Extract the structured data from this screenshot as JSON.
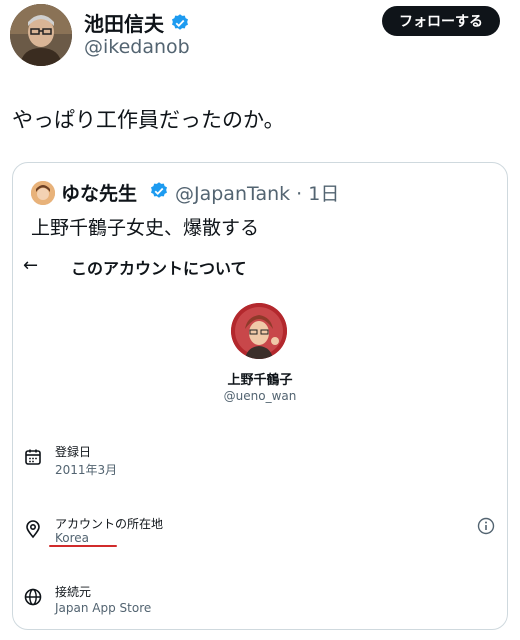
{
  "header": {
    "display_name": "池田信夫",
    "handle": "@ikedanob",
    "follow_label": "フォローする",
    "verified_icon": "verified-badge-icon"
  },
  "tweet": {
    "text": "やっぱり工作員だったのか。"
  },
  "quote": {
    "display_name": "ゆな先生",
    "handle_time": "@JapanTank · 1日",
    "text": "上野千鶴子女史、爆散する"
  },
  "about": {
    "title": "このアカウントについて",
    "profile_name": "上野千鶴子",
    "profile_handle": "@ueno_wan",
    "rows": [
      {
        "label": "登録日",
        "value": "2011年3月",
        "icon": "calendar-icon"
      },
      {
        "label": "アカウントの所在地",
        "value": "Korea",
        "icon": "location-pin-icon"
      },
      {
        "label": "接続元",
        "value": "Japan App Store",
        "icon": "globe-icon"
      }
    ]
  },
  "colors": {
    "verified": "#1d9bf0",
    "follow_bg": "#0f1419",
    "underline": "#d12b2b",
    "secondary_text": "#536471"
  }
}
